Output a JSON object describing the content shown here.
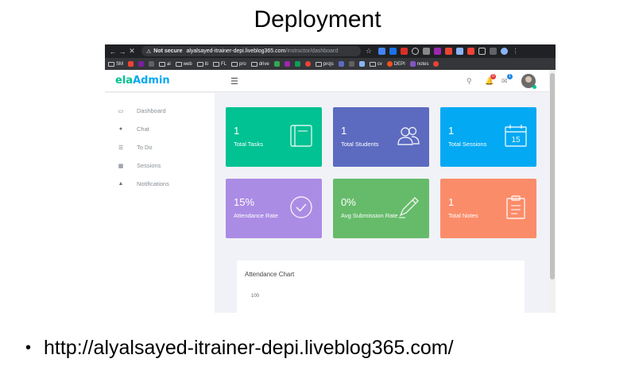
{
  "slide": {
    "title": "Deployment",
    "bullet_url": "http://alyalsayed-itrainer-depi.liveblog365.com/"
  },
  "browser": {
    "security_label": "Not secure",
    "url_host": "alyalsayed-itrainer-depi.liveblog365.com",
    "url_path": "/instructor/dashboard",
    "bookmarks": [
      "SM",
      "ai",
      "web",
      "iti",
      "FL",
      "pro",
      "drive",
      "projs",
      "cv",
      "DEPI",
      "notes"
    ]
  },
  "app": {
    "logo_prefix": "e",
    "logo_mid": "la",
    "logo_suffix": "Admin",
    "notification_count": "0",
    "message_count": "1"
  },
  "sidebar": {
    "items": [
      {
        "label": "Dashboard",
        "icon": "laptop-icon"
      },
      {
        "label": "Chat",
        "icon": "chat-icon"
      },
      {
        "label": "To Do",
        "icon": "list-icon"
      },
      {
        "label": "Sessions",
        "icon": "calendar-icon"
      },
      {
        "label": "Notifications",
        "icon": "bell-icon"
      }
    ]
  },
  "cards": [
    {
      "value": "1",
      "label": "Total Tasks",
      "icon": "book-icon",
      "color": "#00c292"
    },
    {
      "value": "1",
      "label": "Total Students",
      "icon": "users-icon",
      "color": "#5c6bc0"
    },
    {
      "value": "1",
      "label": "Total Sessions",
      "icon": "calendar-15-icon",
      "icon_text": "15",
      "color": "#03a9f3"
    },
    {
      "value": "15%",
      "label": "Attendance Rate",
      "icon": "check-circle-icon",
      "color": "#ab8ce4"
    },
    {
      "value": "0%",
      "label": "Avg Submission Rate",
      "icon": "pencil-icon",
      "color": "#66bb6a"
    },
    {
      "value": "1",
      "label": "Total Notes",
      "icon": "clipboard-icon",
      "color": "#fb8c6a"
    }
  ],
  "chart": {
    "title": "Attendance Chart",
    "y_tick_top": "100"
  }
}
